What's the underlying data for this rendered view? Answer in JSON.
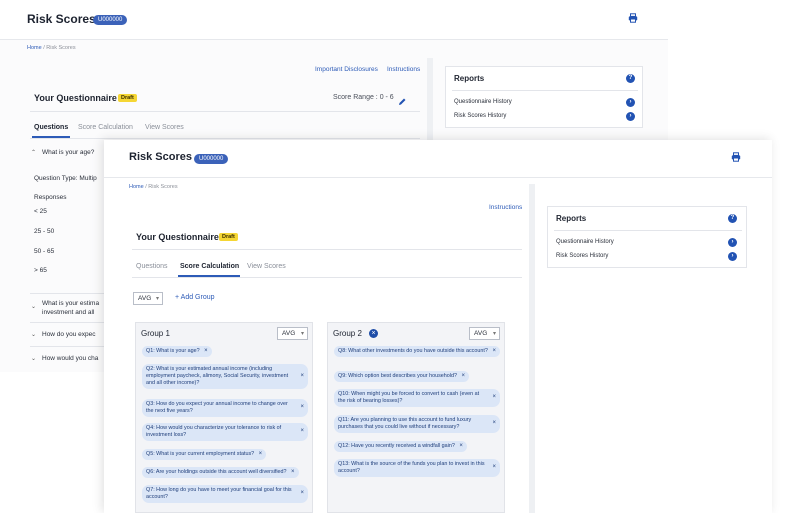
{
  "app": {
    "title": "Risk Scores",
    "user_id": "U000000"
  },
  "breadcrumb": {
    "home": "Home",
    "separator": "/",
    "current": "Risk Scores"
  },
  "links": {
    "important_disclosures": "Important Disclosures",
    "instructions": "Instructions"
  },
  "questionnaire": {
    "title": "Your Questionnaire",
    "status": "Draft",
    "score_range": "Score Range : 0 - 6"
  },
  "tabs": [
    "Questions",
    "Score Calculation",
    "View Scores"
  ],
  "reports": {
    "title": "Reports",
    "items": [
      "Questionnaire History",
      "Risk Scores History"
    ]
  },
  "back_questions": {
    "q1": "What is your age?",
    "question_type": "Question Type: Multip",
    "responses_label": "Responses",
    "responses": [
      "< 25",
      "25 - 50",
      "50 - 65",
      "> 65"
    ],
    "collapsed": [
      "What is your estima",
      "investment and all",
      "How do you expec",
      "How would you cha"
    ]
  },
  "score_calc": {
    "method": "AVG",
    "add_group": "+ Add Group",
    "groups": [
      {
        "name": "Group 1",
        "method": "AVG",
        "chips": [
          "Q1: What is your age?",
          "Q2: What is your estimated annual income (including employment paycheck, alimony, Social Security, investment and all other income)?",
          "Q3: How do you expect your annual income to change over the next five years?",
          "Q4: How would you characterize your tolerance to risk of investment loss?",
          "Q5: What is your current employment status?",
          "Q6: Are your holdings outside this account well diversified?",
          "Q7: How long do you have to meet your financial goal for this account?"
        ]
      },
      {
        "name": "Group 2",
        "method": "AVG",
        "chips": [
          "Q8: What other investments do you have outside this account?",
          "Q9: Which option best describes your household?",
          "Q10: When might you be forced to convert to cash (even at the risk of bearing losses)?",
          "Q11: Are you planning to use this account to fund luxury purchases that you could live without if necessary?",
          "Q12: Have you recently received a windfall gain?",
          "Q13: What is the source of the funds you plan to invest in this account?"
        ]
      }
    ]
  },
  "icons": {
    "print": "printer-icon",
    "edit": "pencil-icon",
    "help": "question-circle-icon",
    "go": "arrow-right-circle-icon",
    "chevron": "chevron-icon",
    "remove": "close-circle-icon",
    "chip_remove": "close-icon"
  },
  "colors": {
    "accent": "#2d5bb7",
    "badge": "#3b62b9",
    "draft": "#f5d634",
    "chip_bg": "#dbe6f7"
  }
}
